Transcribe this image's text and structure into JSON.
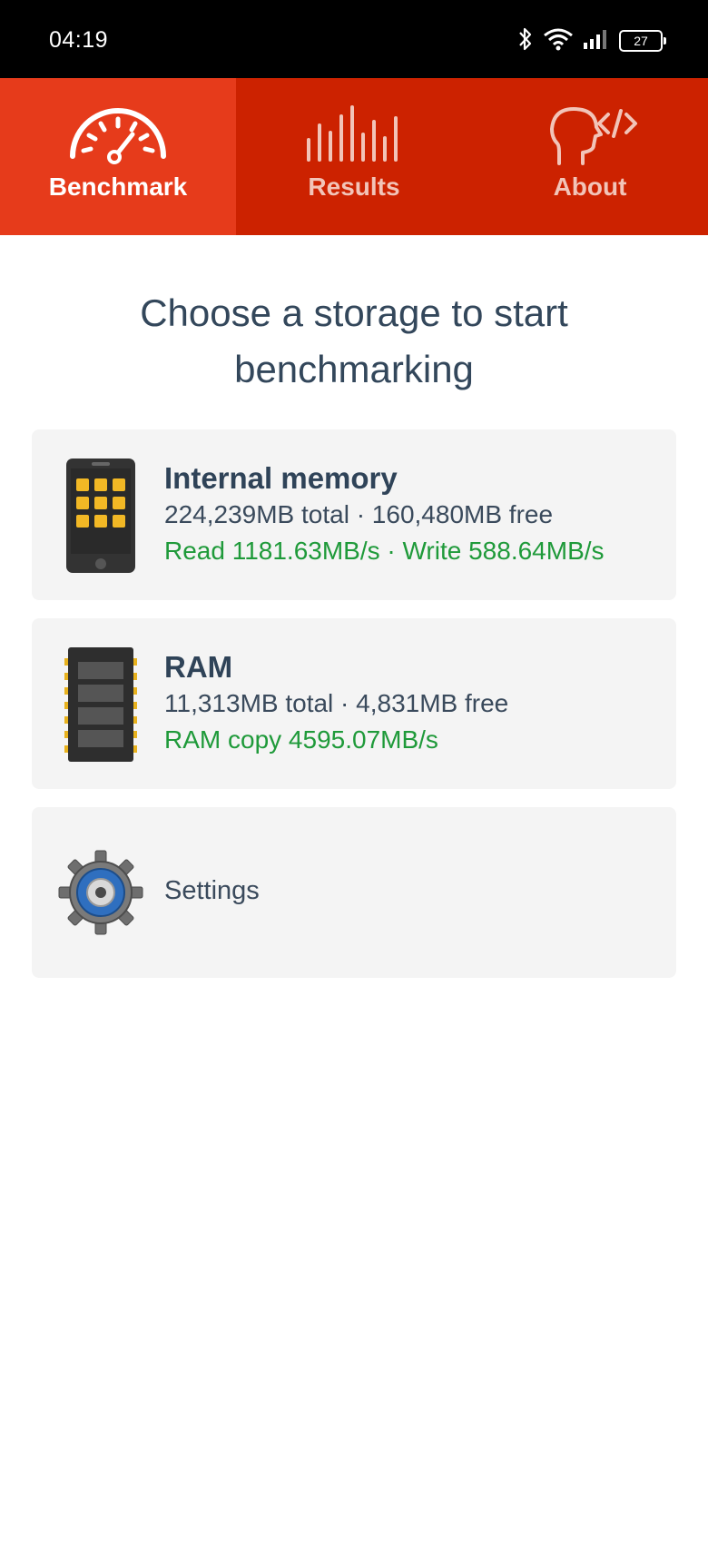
{
  "status_bar": {
    "time": "04:19",
    "battery": "27",
    "icons": [
      "bluetooth-icon",
      "wifi-icon",
      "signal-icon",
      "battery-icon"
    ]
  },
  "tabs": [
    {
      "label": "Benchmark",
      "icon": "speedometer-icon",
      "active": true
    },
    {
      "label": "Results",
      "icon": "bars-icon",
      "active": false
    },
    {
      "label": "About",
      "icon": "head-code-icon",
      "active": false
    }
  ],
  "main": {
    "heading_line1": "Choose a storage to start",
    "heading_line2": "benchmarking"
  },
  "storages": {
    "internal": {
      "title": "Internal memory",
      "sizes": "224,239MB total · 160,480MB free",
      "speed": "Read 1181.63MB/s · Write 588.64MB/s",
      "icon": "phone-icon"
    },
    "ram": {
      "title": "RAM",
      "sizes": "11,313MB total · 4,831MB free",
      "speed": "RAM copy 4595.07MB/s",
      "icon": "ram-chip-icon"
    },
    "settings": {
      "label": "Settings",
      "icon": "gear-icon"
    }
  },
  "colors": {
    "tab_bar": "#cc2200",
    "tab_active": "#e63b1b",
    "speed_text": "#1f9a3a",
    "title_text": "#2f4358"
  }
}
